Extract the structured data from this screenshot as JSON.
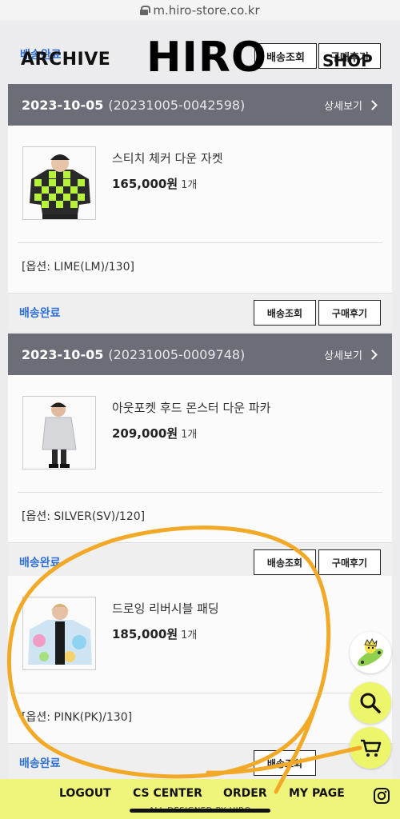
{
  "browser": {
    "url": "m.hiro-store.co.kr"
  },
  "header": {
    "status": "배송완료",
    "track_label": "배송조회",
    "review_label": "구매후기",
    "archive": "ARCHIVE",
    "logo": "HIRO",
    "shop": "SHOP"
  },
  "orders": [
    {
      "date": "2023-10-05",
      "number": "(20231005-0042598)",
      "detail_label": "상세보기",
      "item": {
        "name": "스티치 체커 다운 자켓",
        "price": "165,000",
        "won": "원",
        "qty": "1개",
        "option": "[옵션: LIME(LM)/130]"
      },
      "status": "배송완료",
      "track_label": "배송조회",
      "review_label": "구매후기"
    },
    {
      "date": "2023-10-05",
      "number": "(20231005-0009748)",
      "detail_label": "상세보기",
      "item": {
        "name": "아웃포켓 후드 몬스터 다운 파카",
        "price": "209,000",
        "won": "원",
        "qty": "1개",
        "option": "[옵션: SILVER(SV)/120]"
      },
      "status": "배송완료",
      "track_label": "배송조회",
      "review_label": "구매후기"
    },
    {
      "item": {
        "name": "드로잉 리버시블 패딩",
        "price": "185,000",
        "won": "원",
        "qty": "1개",
        "option": "[옵션: PINK(PK)/130]"
      },
      "status": "배송완료",
      "track_label": "배송조회"
    }
  ],
  "fabs": [
    "skateboard-mascot-icon",
    "search-icon",
    "cart-icon"
  ],
  "bottom_nav": {
    "logout": "LOGOUT",
    "cs_center": "CS CENTER",
    "order": "ORDER",
    "my_page": "MY PAGE",
    "credit": "ALL DESIGNED BY HIRO"
  },
  "colors": {
    "accent": "#eef57a",
    "status_blue": "#2f6fd6",
    "order_header": "#6b6e76",
    "annotation": "#f2a928"
  }
}
